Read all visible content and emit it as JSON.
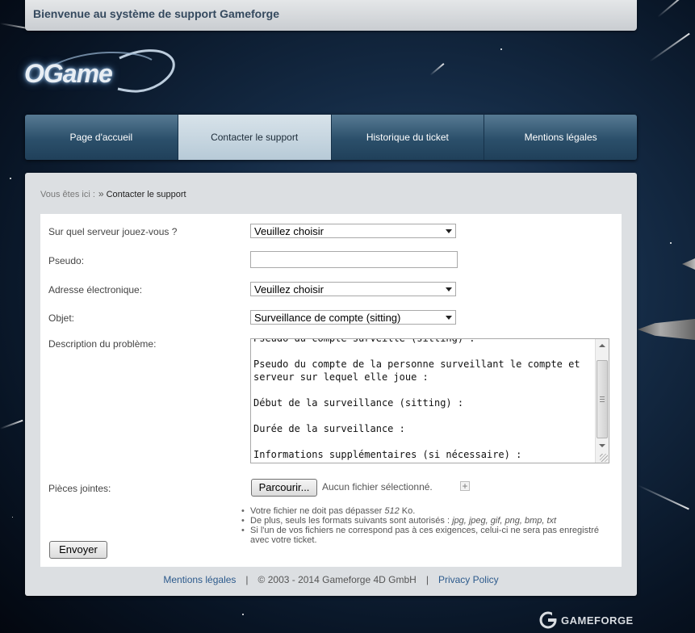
{
  "banner": {
    "title": "Bienvenue au système de support Gameforge"
  },
  "logo": {
    "text": "OGame"
  },
  "nav": {
    "tabs": [
      {
        "label": "Page d'accueil"
      },
      {
        "label": "Contacter le support"
      },
      {
        "label": "Historique du ticket"
      },
      {
        "label": "Mentions légales"
      }
    ]
  },
  "breadcrumb": {
    "prefix": "Vous êtes ici :",
    "separator": "»",
    "current": "Contacter le support"
  },
  "form": {
    "server": {
      "label": "Sur quel serveur jouez-vous ?",
      "value": "Veuillez choisir"
    },
    "pseudo": {
      "label": "Pseudo:",
      "value": ""
    },
    "email": {
      "label": "Adresse électronique:",
      "value": "Veuillez choisir"
    },
    "subject": {
      "label": "Objet:",
      "value": "Surveillance de compte (sitting)"
    },
    "description": {
      "label": "Description du problème:",
      "value": "Pseudo du compte surveillé (sitting) :\n\nPseudo du compte de la personne surveillant le compte et serveur sur lequel elle joue :\n\nDébut de la surveillance (sitting) :\n\nDurée de la surveillance :\n\nInformations supplémentaires (si nécessaire) :"
    },
    "attachments": {
      "label": "Pièces jointes:",
      "browse_label": "Parcourir...",
      "no_file": "Aucun fichier sélectionné.",
      "add_label": "+"
    },
    "notes": {
      "size_prefix": "Votre fichier ne doit pas dépasser ",
      "size_value": "512",
      "size_unit": " Ko.",
      "formats_prefix": "De plus, seuls les formats suivants sont autorisés : ",
      "formats_list": "jpg, jpeg, gif, png, bmp, txt",
      "warning": "Si l'un de vos fichiers ne correspond pas à ces exigences, celui-ci ne sera pas enregistré avec votre ticket."
    },
    "submit_label": "Envoyer"
  },
  "footer": {
    "legal_label": "Mentions légales",
    "separator": "|",
    "copyright": "© 2003 - 2014 Gameforge 4D GmbH",
    "privacy_label": "Privacy Policy"
  },
  "brand": {
    "text": "GAMEFORGE"
  },
  "colors": {
    "nav_bg": "#2b4f6a",
    "nav_active": "#c6d6e1",
    "link": "#2c5a8c",
    "banner_title": "#34495e"
  },
  "icons": {
    "logo_ring": "planet-ring-icon",
    "select_caret": "chevron-down-icon",
    "brand": "gameforge-logo-icon"
  }
}
